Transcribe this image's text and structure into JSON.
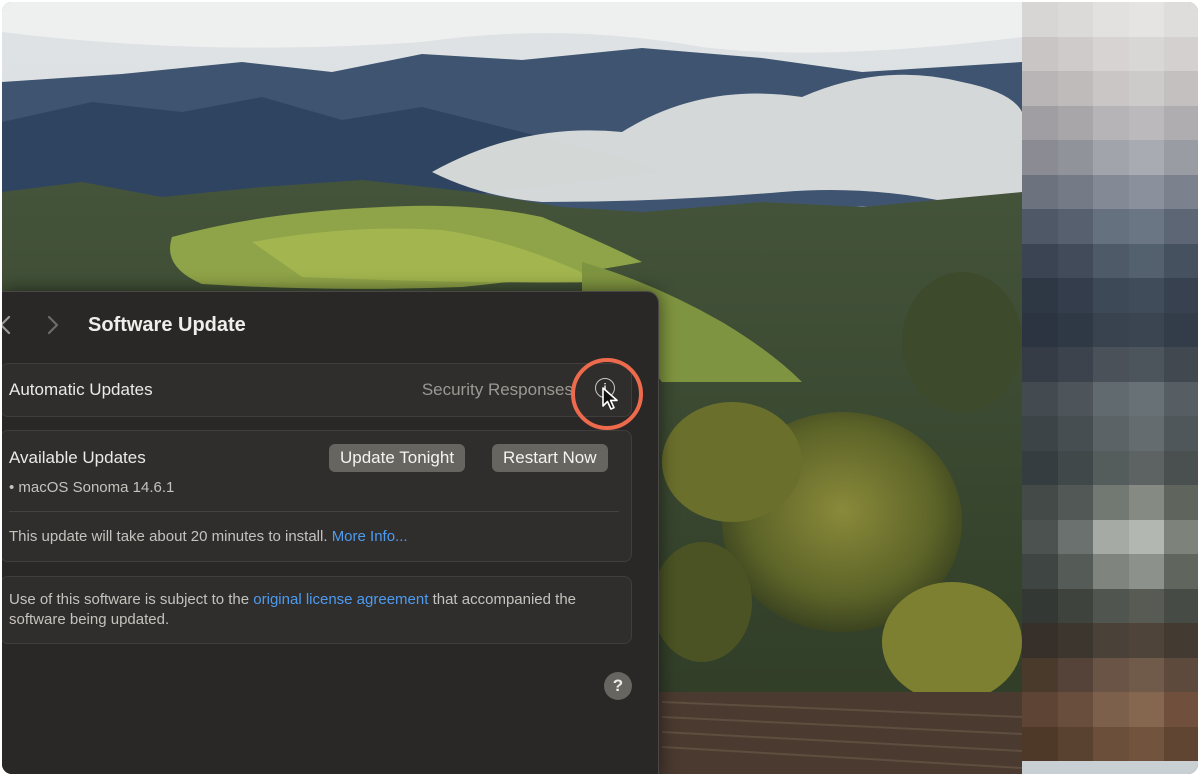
{
  "window": {
    "title": "Software Update"
  },
  "automatic_updates": {
    "label": "Automatic Updates",
    "value": "Security Responses",
    "info_icon": "i"
  },
  "available_updates": {
    "label": "Available Updates",
    "update_tonight_label": "Update Tonight",
    "restart_now_label": "Restart Now",
    "items": [
      "• macOS Sonoma 14.6.1"
    ],
    "note": "This update will take about 20 minutes to install.",
    "more_info_label": "More Info..."
  },
  "license": {
    "text_before": "Use of this software is subject to the",
    "link_label": "original license agreement",
    "text_after": "that accompanied the software being updated."
  },
  "help": {
    "label": "?"
  },
  "icons": {
    "back": "chevron-left-icon",
    "forward": "chevron-right-icon",
    "info": "info-icon",
    "pointer": "cursor-pointer-icon",
    "help": "question-icon"
  },
  "colors": {
    "accent_link": "#4c9bf0",
    "highlight_ring": "#ee6a4c",
    "window_bg": "#2a2826",
    "button_bg": "#67655f"
  }
}
